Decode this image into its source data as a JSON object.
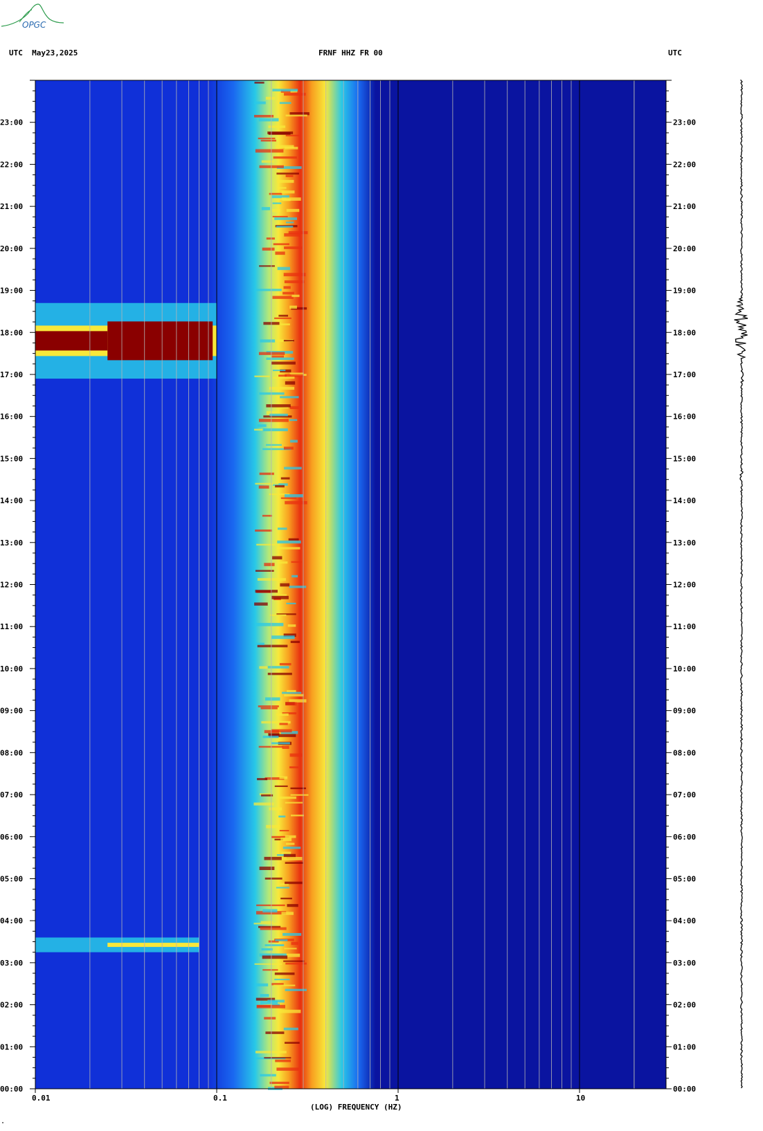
{
  "header": {
    "left": "UTC  May23,2025",
    "center": "FRNF HHZ FR 00",
    "right": "UTC"
  },
  "logo": {
    "text": "OPGC",
    "color": "#2a9a4a"
  },
  "footer_mark": "\"",
  "colors": {
    "background_blue": "#0a14a0",
    "low_band_blue": "#1030d8",
    "cyan": "#28c8e8",
    "yellow": "#f8e83a",
    "red": "#e83010",
    "dark_red": "#8a0000",
    "grid_line": "#b4b4b4"
  },
  "chart_data": {
    "type": "heatmap",
    "title": "FRNF HHZ FR 00",
    "xlabel": "(LOG) FREQUENCY (HZ)",
    "ylabel": "UTC",
    "x_scale": "log",
    "xlim": [
      0.01,
      30
    ],
    "x_ticks": [
      {
        "value": 0.01,
        "label": "0.01"
      },
      {
        "value": 0.1,
        "label": "0.1"
      },
      {
        "value": 1,
        "label": "1"
      },
      {
        "value": 10,
        "label": "10"
      }
    ],
    "ylim_hours": [
      0,
      24
    ],
    "y_ticks": [
      "00:00",
      "01:00",
      "02:00",
      "03:00",
      "04:00",
      "05:00",
      "06:00",
      "07:00",
      "08:00",
      "09:00",
      "10:00",
      "11:00",
      "12:00",
      "13:00",
      "14:00",
      "15:00",
      "16:00",
      "17:00",
      "18:00",
      "19:00",
      "20:00",
      "21:00",
      "22:00",
      "23:00"
    ],
    "microseism_peak_hz": [
      0.18,
      0.25
    ],
    "events": [
      {
        "start_hour": 16.9,
        "end_hour": 18.7,
        "max_freq_hz": 0.1,
        "intensity": "high"
      },
      {
        "start_hour": 3.25,
        "end_hour": 3.6,
        "max_freq_hz": 0.08,
        "intensity": "medium"
      }
    ],
    "trace": "seismogram with event near 18:00"
  }
}
